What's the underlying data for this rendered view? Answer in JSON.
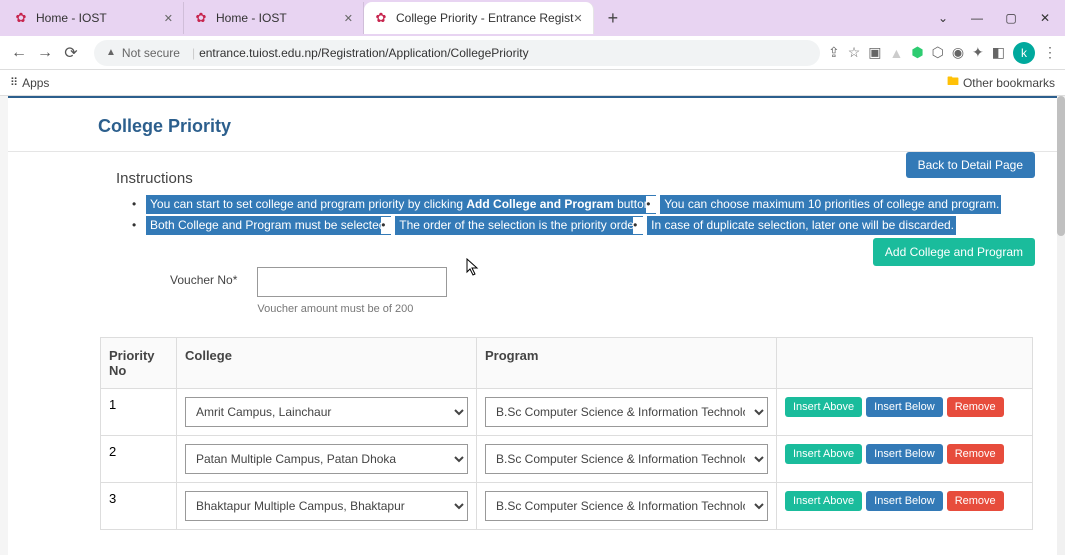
{
  "tabs": [
    {
      "label": "Home - IOST"
    },
    {
      "label": "Home - IOST"
    },
    {
      "label": "College Priority - Entrance Regist"
    }
  ],
  "addressBar": {
    "notSecure": "Not secure",
    "url": "entrance.tuiost.edu.np/Registration/Application/CollegePriority"
  },
  "bookmarks": {
    "apps": "Apps",
    "other": "Other bookmarks"
  },
  "page": {
    "title": "College Priority",
    "backBtn": "Back to Detail Page",
    "instructionsTitle": "Instructions",
    "instructions": [
      {
        "pre": "You can start to set college and program priority by clicking ",
        "bold": "Add College and Program",
        "post": " button."
      },
      {
        "pre": "You can choose maximum 10 priorities of college and program.",
        "bold": "",
        "post": ""
      },
      {
        "pre": "Both College and Program must be selected.",
        "bold": "",
        "post": ""
      },
      {
        "pre": "The order of the selection is the priority order.",
        "bold": "",
        "post": ""
      },
      {
        "pre": "In case of duplicate selection, later one will be discarded.",
        "bold": "",
        "post": ""
      }
    ],
    "addBtn": "Add College and Program",
    "voucher": {
      "label": "Voucher No*",
      "help": "Voucher amount must be of 200"
    },
    "table": {
      "headers": {
        "priority": "Priority No",
        "college": "College",
        "program": "Program"
      },
      "rows": [
        {
          "no": "1",
          "college": "Amrit Campus, Lainchaur",
          "program": "B.Sc Computer Science & Information Technology |"
        },
        {
          "no": "2",
          "college": "Patan Multiple Campus, Patan Dhoka",
          "program": "B.Sc Computer Science & Information Technology |"
        },
        {
          "no": "3",
          "college": "Bhaktapur Multiple Campus, Bhaktapur",
          "program": "B.Sc Computer Science & Information Technology |"
        }
      ],
      "actions": {
        "insertAbove": "Insert Above",
        "insertBelow": "Insert Below",
        "remove": "Remove"
      }
    }
  }
}
